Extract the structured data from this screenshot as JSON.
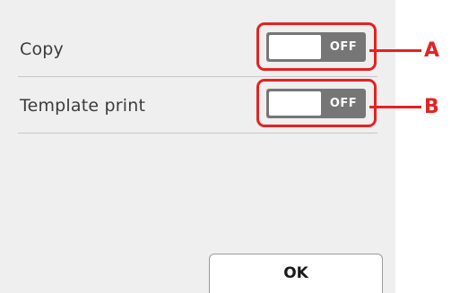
{
  "settings": [
    {
      "label": "Copy",
      "state": "OFF",
      "callout": "A"
    },
    {
      "label": "Template print",
      "state": "OFF",
      "callout": "B"
    }
  ],
  "ok_button": {
    "label": "OK"
  },
  "colors": {
    "screen_background": "#efefef",
    "toggle_off": "#767676",
    "callout_red": "#e52222"
  }
}
